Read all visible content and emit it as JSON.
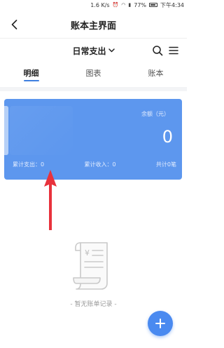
{
  "status_bar": {
    "speed": "1.6 K/s",
    "battery": "77%",
    "time": "下午4:34"
  },
  "header": {
    "title": "账本主界面",
    "back_icon": "chevron-left-icon"
  },
  "filter": {
    "selected": "日常支出",
    "search_icon": "search-icon",
    "menu_icon": "menu-icon"
  },
  "tabs": [
    {
      "label": "明细",
      "active": true
    },
    {
      "label": "图表",
      "active": false
    },
    {
      "label": "账本",
      "active": false
    }
  ],
  "summary": {
    "balance_label": "余额（元）",
    "balance_value": "0",
    "total_expense": "累计支出：0",
    "total_income": "累计收入：0",
    "total_count": "共计0笔",
    "card_color": "#5d97ee"
  },
  "empty_state": {
    "icon": "receipt-scroll-icon",
    "text": "- 暂无账单记录 -"
  },
  "fab": {
    "icon": "plus-icon",
    "color": "#4a8af0"
  },
  "annotation": {
    "color": "#e8323c"
  }
}
